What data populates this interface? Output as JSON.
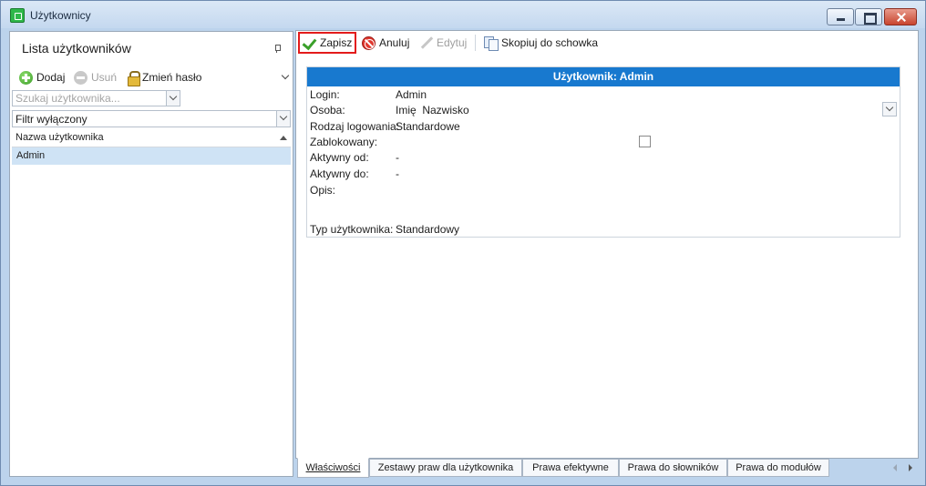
{
  "window": {
    "title": "Użytkownicy"
  },
  "left_panel": {
    "title": "Lista użytkowników",
    "toolbar": {
      "add_label": "Dodaj",
      "remove_label": "Usuń",
      "change_password_label": "Zmień hasło"
    },
    "search": {
      "placeholder": "Szukaj użytkownika..."
    },
    "filter": {
      "value": "Filtr wyłączony"
    },
    "grid": {
      "column_header": "Nazwa użytkownika",
      "rows": [
        "Admin"
      ]
    }
  },
  "toolbar": {
    "save_label": "Zapisz",
    "cancel_label": "Anuluj",
    "edit_label": "Edytuj",
    "copy_label": "Skopiuj do schowka"
  },
  "details": {
    "header": "Użytkownik: Admin",
    "fields": [
      {
        "label": "Login:",
        "value": "Admin"
      },
      {
        "label": "Osoba:",
        "value": "Imię  Nazwisko"
      },
      {
        "label": "Rodzaj logowania:",
        "value": "Standardowe"
      },
      {
        "label": "Zablokowany:",
        "value": ""
      },
      {
        "label": "Aktywny od:",
        "value": "-"
      },
      {
        "label": "Aktywny do:",
        "value": "-"
      },
      {
        "label": "Opis:",
        "value": ""
      },
      {
        "label": "Typ użytkownika:",
        "value": "Standardowy"
      }
    ]
  },
  "tabs": [
    {
      "label": "Właściwości",
      "active": true
    },
    {
      "label": "Zestawy praw dla użytkownika",
      "active": false
    },
    {
      "label": "Prawa efektywne",
      "active": false
    },
    {
      "label": "Prawa do słowników",
      "active": false
    },
    {
      "label": "Prawa do modułów",
      "active": false
    }
  ]
}
